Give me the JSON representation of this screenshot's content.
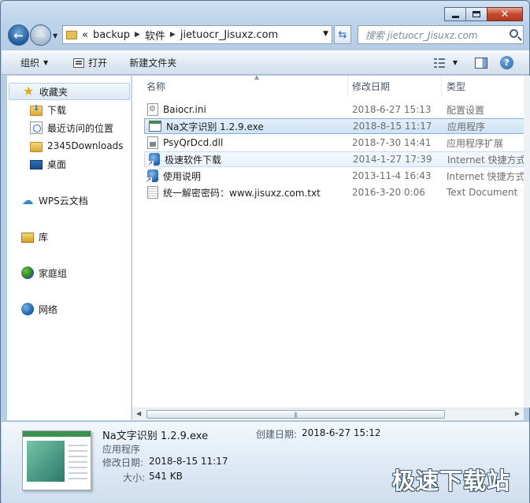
{
  "address": {
    "prefix": "«",
    "crumbs": [
      "backup",
      "软件",
      "jietuocr_Jisuxz.com"
    ]
  },
  "search": {
    "placeholder": "搜索 jietuocr_Jisuxz.com"
  },
  "toolbar": {
    "organize_label": "组织",
    "open_label": "打开",
    "new_folder_label": "新建文件夹"
  },
  "sidebar": {
    "items": [
      {
        "label": "收藏夹",
        "icon": "star-icon"
      },
      {
        "label": "下载",
        "icon": "download-folder-icon"
      },
      {
        "label": "最近访问的位置",
        "icon": "recent-places-icon"
      },
      {
        "label": "2345Downloads",
        "icon": "folder-icon"
      },
      {
        "label": "桌面",
        "icon": "desktop-icon"
      },
      {
        "label": "WPS云文档",
        "icon": "cloud-icon"
      },
      {
        "label": "库",
        "icon": "library-icon"
      },
      {
        "label": "家庭组",
        "icon": "homegroup-icon"
      },
      {
        "label": "网络",
        "icon": "network-icon"
      }
    ]
  },
  "columns": {
    "name": "名称",
    "date": "修改日期",
    "type": "类型"
  },
  "files": [
    {
      "name": "Baiocr.ini",
      "date": "2018-6-27 15:13",
      "type": "配置设置",
      "icon": "ini-file-icon"
    },
    {
      "name": "Na文字识别 1.2.9.exe",
      "date": "2018-8-15 11:17",
      "type": "应用程序",
      "icon": "exe-file-icon"
    },
    {
      "name": "PsyQrDcd.dll",
      "date": "2018-7-30 14:41",
      "type": "应用程序扩展",
      "icon": "dll-file-icon"
    },
    {
      "name": "极速软件下载",
      "date": "2014-1-27 17:39",
      "type": "Internet 快捷方式",
      "icon": "shortcut-icon"
    },
    {
      "name": "使用说明",
      "date": "2013-11-4 16:43",
      "type": "Internet 快捷方式",
      "icon": "shortcut-icon"
    },
    {
      "name": "统一解密密码：www.jisuxz.com.txt",
      "date": "2016-3-20 0:06",
      "type": "Text Document",
      "icon": "text-file-icon"
    }
  ],
  "details": {
    "name": "Na文字识别 1.2.9.exe",
    "type": "应用程序",
    "modified_label": "修改日期:",
    "modified_value": "2018-8-15 11:17",
    "created_label": "创建日期:",
    "created_value": "2018-6-27 15:12",
    "size_label": "大小:",
    "size_value": "541 KB"
  },
  "watermark": "极速下载站"
}
